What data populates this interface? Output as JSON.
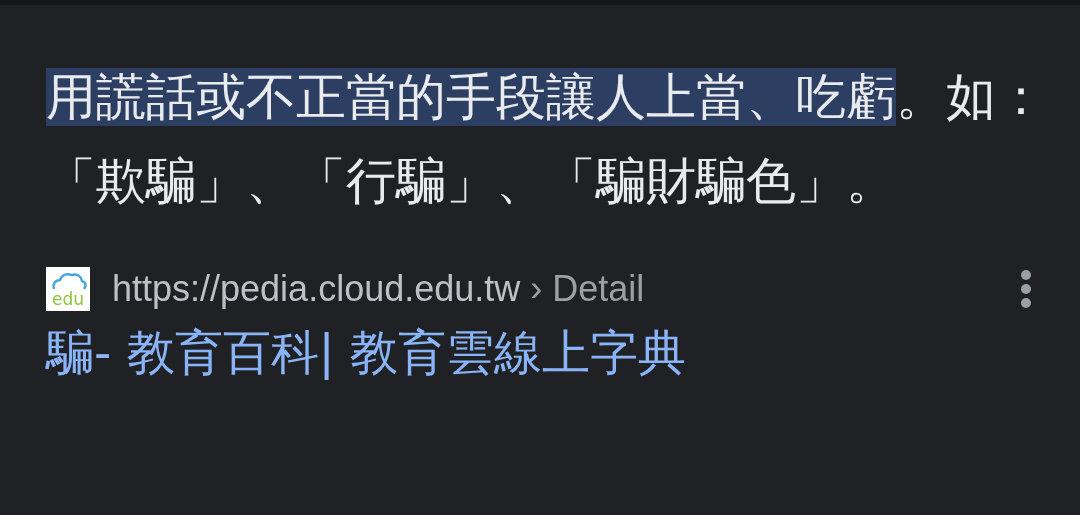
{
  "snippet": {
    "selected_text": "用謊話或不正當的手段讓人上當、吃虧",
    "text": "。如：「欺騙」、「行騙」、「騙財騙色」。"
  },
  "result": {
    "favicon_text": "edu",
    "url": "https://pedia.cloud.edu.tw",
    "breadcrumb": "› Detail",
    "title": "騙- 教育百科| 教育雲線上字典"
  }
}
